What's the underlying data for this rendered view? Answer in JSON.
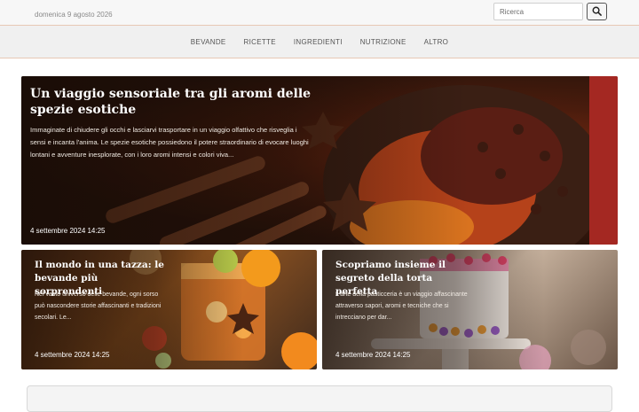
{
  "header": {
    "date": "domenica 9 agosto 2026",
    "search_placeholder": "Ricerca"
  },
  "nav": {
    "items": [
      "BEVANDE",
      "RICETTE",
      "INGREDIENTI",
      "NUTRIZIONE",
      "ALTRO"
    ]
  },
  "articles": {
    "featured": {
      "title": "Un viaggio sensoriale tra gli aromi delle spezie esotiche",
      "excerpt": "Immaginate di chiudere gli occhi e lasciarvi trasportare in un viaggio olfattivo che risveglia i sensi e incanta l'anima. Le spezie esotiche possiedono il potere straordinario di evocare luoghi lontani e avventure inesplorate, con i loro aromi intensi e colori viva...",
      "date": "4 settembre 2024 14:25"
    },
    "second": {
      "title": "Il mondo in una tazza: le bevande più sorprendenti",
      "excerpt": "Nel vasto universo delle bevande, ogni sorso può nascondere storie affascinanti e tradizioni secolari. Le...",
      "date": "4 settembre 2024 14:25"
    },
    "third": {
      "title": "Scopriamo insieme il segreto della torta perfetta",
      "excerpt": "L'arte della pasticceria è un viaggio affascinante attraverso sapori, aromi e tecniche che si intrecciano per dar...",
      "date": "4 settembre 2024 14:25"
    }
  }
}
